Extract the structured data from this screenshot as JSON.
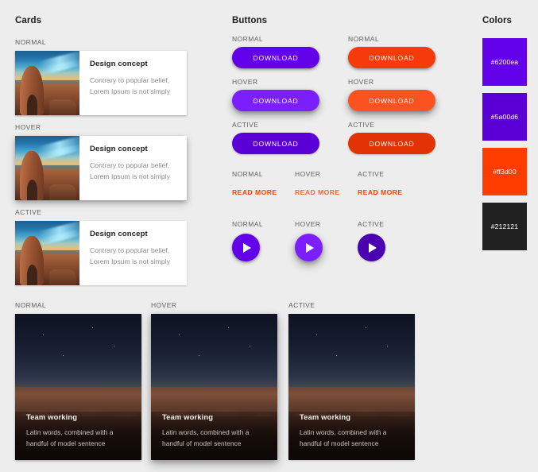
{
  "sections": {
    "cards_title": "Cards",
    "buttons_title": "Buttons",
    "colors_title": "Colors"
  },
  "states": {
    "normal": "NORMAL",
    "hover": "HOVER",
    "active": "ACTIVE"
  },
  "cards": [
    {
      "state": "NORMAL",
      "title": "Design concept",
      "line1": "Contrary to popular belief,",
      "line2": "Lorem Ipsum is not simply"
    },
    {
      "state": "HOVER",
      "title": "Design concept",
      "line1": "Contrary to popular belief,",
      "line2": "Lorem Ipsum is not simply"
    },
    {
      "state": "ACTIVE",
      "title": "Design concept",
      "line1": "Contrary to popular belief,",
      "line2": "Lorem Ipsum is not simply"
    }
  ],
  "buttons": {
    "pill": [
      {
        "state": "NORMAL",
        "label": "DOWNLOAD",
        "color": "#6200ea"
      },
      {
        "state": "NORMAL",
        "label": "DOWNLOAD",
        "color": "#f43b09"
      },
      {
        "state": "HOVER",
        "label": "DOWNLOAD",
        "color": "#7c1fff"
      },
      {
        "state": "HOVER",
        "label": "DOWNLOAD",
        "color": "#fb5222"
      },
      {
        "state": "ACTIVE",
        "label": "DOWNLOAD",
        "color": "#5a00d6"
      },
      {
        "state": "ACTIVE",
        "label": "DOWNLOAD",
        "color": "#e23305"
      }
    ],
    "links": [
      {
        "state": "NORMAL",
        "label": "READ MORE",
        "color": "#ff3d00"
      },
      {
        "state": "HOVER",
        "label": "READ MORE",
        "color": "#ff6333"
      },
      {
        "state": "ACTIVE",
        "label": "READ MORE",
        "color": "#ff3d00"
      }
    ],
    "play": [
      {
        "state": "NORMAL",
        "icon": "play-icon",
        "color": "#6200ea"
      },
      {
        "state": "HOVER",
        "icon": "play-icon",
        "color": "#7c1fff"
      },
      {
        "state": "ACTIVE",
        "icon": "play-icon",
        "color": "#4a00b0"
      }
    ]
  },
  "colors": [
    {
      "hex": "#6200ea"
    },
    {
      "hex": "#5a00d6"
    },
    {
      "hex": "#ff3d00"
    },
    {
      "hex": "#212121"
    }
  ],
  "image_cards": [
    {
      "state": "NORMAL",
      "title": "Team working",
      "line1": "Latin words, combined with a",
      "line2": "handful of model sentence"
    },
    {
      "state": "HOVER",
      "title": "Team working",
      "line1": "Latin words, combined with a",
      "line2": "handful of model sentence"
    },
    {
      "state": "ACTIVE",
      "title": "Team working",
      "line1": "Latin words, combined with a",
      "line2": "handful of model sentence"
    }
  ],
  "background_color": "#ededed"
}
